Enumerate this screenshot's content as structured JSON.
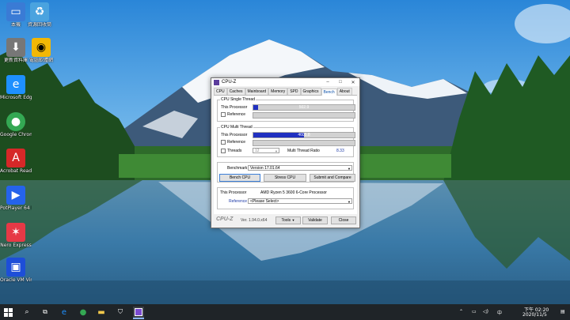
{
  "desktop": {
    "icons": [
      {
        "label": "本機",
        "icon": "computer-icon",
        "color": "#3a7bd5"
      },
      {
        "label": "資源回收筒",
        "icon": "recycle-bin-icon",
        "color": "#4aa3df"
      },
      {
        "label": "更新資料庫",
        "icon": "update-icon",
        "color": "#777777"
      },
      {
        "label": "電腦軟體網",
        "icon": "app-icon",
        "color": "#f2b705"
      },
      {
        "label": "Microsoft Edge",
        "icon": "edge-icon",
        "color": "#1e90ff"
      },
      {
        "label": "Google Chrome",
        "icon": "chrome-icon",
        "color": "#34a853"
      },
      {
        "label": "Acrobat Reader DC",
        "icon": "acrobat-icon",
        "color": "#d62828"
      },
      {
        "label": "PotPlayer 64 bit",
        "icon": "potplayer-icon",
        "color": "#2563eb"
      },
      {
        "label": "Nero Express",
        "icon": "nero-icon",
        "color": "#e63946"
      },
      {
        "label": "Oracle VM VirtualBox",
        "icon": "virtualbox-icon",
        "color": "#1d4ed8"
      }
    ]
  },
  "cpuz": {
    "title": "CPU-Z",
    "tabs": [
      "CPU",
      "Caches",
      "Mainboard",
      "Memory",
      "SPD",
      "Graphics",
      "Bench",
      "About"
    ],
    "active_tab": "Bench",
    "single": {
      "title": "CPU Single Thread",
      "this_label": "This Processor",
      "this_value": "502.9",
      "this_fraction": 0.05,
      "ref_label": "Reference"
    },
    "multi": {
      "title": "CPU Multi Thread",
      "this_label": "This Processor",
      "this_value": "4605.8",
      "this_fraction": 0.5,
      "ref_label": "Reference",
      "threads_label": "Threads",
      "threads_value": "12",
      "ratio_label": "Multi Thread Ratio",
      "ratio_value": "8.33"
    },
    "benchmark_label": "Benchmark",
    "benchmark_version": "Version 17.01.64",
    "buttons": {
      "bench": "Bench CPU",
      "stress": "Stress CPU",
      "submit": "Submit and Compare"
    },
    "this_processor_label": "This Processor",
    "this_processor_value": "AMD Ryzen 5 3600 6-Core Processor",
    "reference_label": "Reference",
    "reference_value": "<Please Select>",
    "footer": {
      "logo": "CPU-Z",
      "version": "Ver. 1.94.0.x64",
      "tools": "Tools",
      "validate": "Validate",
      "close": "Close"
    }
  },
  "taskbar": {
    "time": "下午 02:20",
    "date": "2020/11/5",
    "ime": "中"
  }
}
